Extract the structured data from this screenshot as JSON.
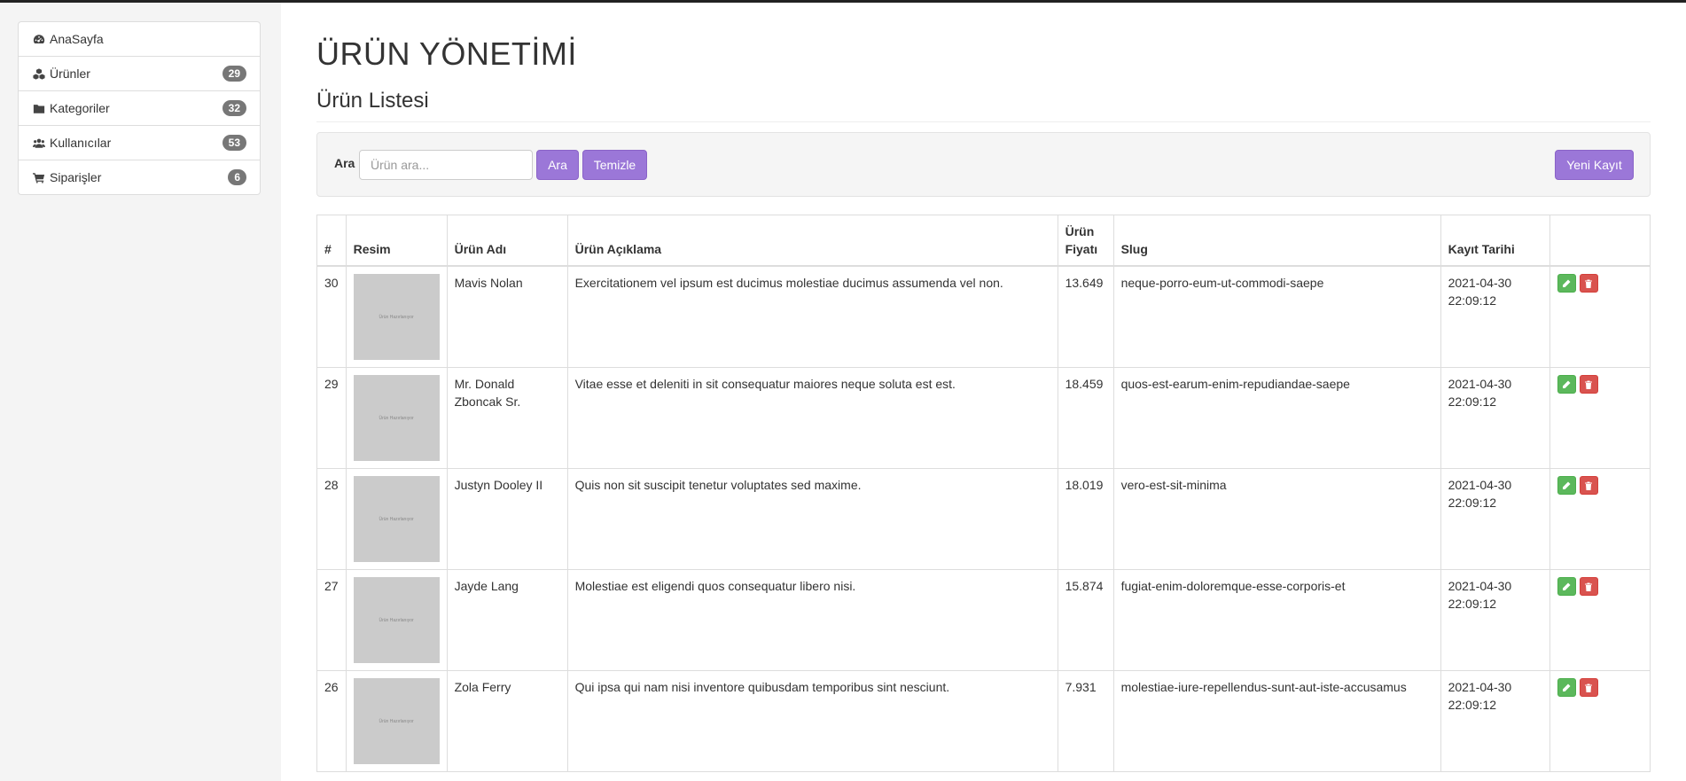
{
  "sidebar": {
    "items": [
      {
        "label": "AnaSayfa",
        "icon": "dashboard-icon",
        "count": null
      },
      {
        "label": "Ürünler",
        "icon": "cubes-icon",
        "count": "29"
      },
      {
        "label": "Kategoriler",
        "icon": "folder-icon",
        "count": "32"
      },
      {
        "label": "Kullanıcılar",
        "icon": "users-icon",
        "count": "53"
      },
      {
        "label": "Siparişler",
        "icon": "cart-icon",
        "count": "6"
      }
    ]
  },
  "page": {
    "title": "ÜRÜN YÖNETİMİ",
    "subtitle": "Ürün Listesi"
  },
  "search": {
    "label": "Ara",
    "placeholder": "Ürün ara...",
    "value": "",
    "search_button": "Ara",
    "clear_button": "Temizle",
    "new_button": "Yeni Kayıt"
  },
  "table": {
    "headers": {
      "id": "#",
      "image": "Resim",
      "name": "Ürün Adı",
      "description": "Ürün Açıklama",
      "price": "Ürün Fiyatı",
      "slug": "Slug",
      "date": "Kayıt Tarihi"
    },
    "thumb_text": "Ürün Hazırlanıyor",
    "rows": [
      {
        "id": "30",
        "name": "Mavis Nolan",
        "description": "Exercitationem vel ipsum est ducimus molestiae ducimus assumenda vel non.",
        "price": "13.649",
        "slug": "neque-porro-eum-ut-commodi-saepe",
        "date": "2021-04-30 22:09:12"
      },
      {
        "id": "29",
        "name": "Mr. Donald Zboncak Sr.",
        "description": "Vitae esse et deleniti in sit consequatur maiores neque soluta est est.",
        "price": "18.459",
        "slug": "quos-est-earum-enim-repudiandae-saepe",
        "date": "2021-04-30 22:09:12"
      },
      {
        "id": "28",
        "name": "Justyn Dooley II",
        "description": "Quis non sit suscipit tenetur voluptates sed maxime.",
        "price": "18.019",
        "slug": "vero-est-sit-minima",
        "date": "2021-04-30 22:09:12"
      },
      {
        "id": "27",
        "name": "Jayde Lang",
        "description": "Molestiae est eligendi quos consequatur libero nisi.",
        "price": "15.874",
        "slug": "fugiat-enim-doloremque-esse-corporis-et",
        "date": "2021-04-30 22:09:12"
      },
      {
        "id": "26",
        "name": "Zola Ferry",
        "description": "Qui ipsa qui nam nisi inventore quibusdam temporibus sint nesciunt.",
        "price": "7.931",
        "slug": "molestiae-iure-repellendus-sunt-aut-iste-accusamus",
        "date": "2021-04-30 22:09:12"
      }
    ]
  },
  "colors": {
    "accent": "#9b77d8",
    "edit": "#5cb85c",
    "delete": "#d9534f",
    "badge": "#777777"
  }
}
